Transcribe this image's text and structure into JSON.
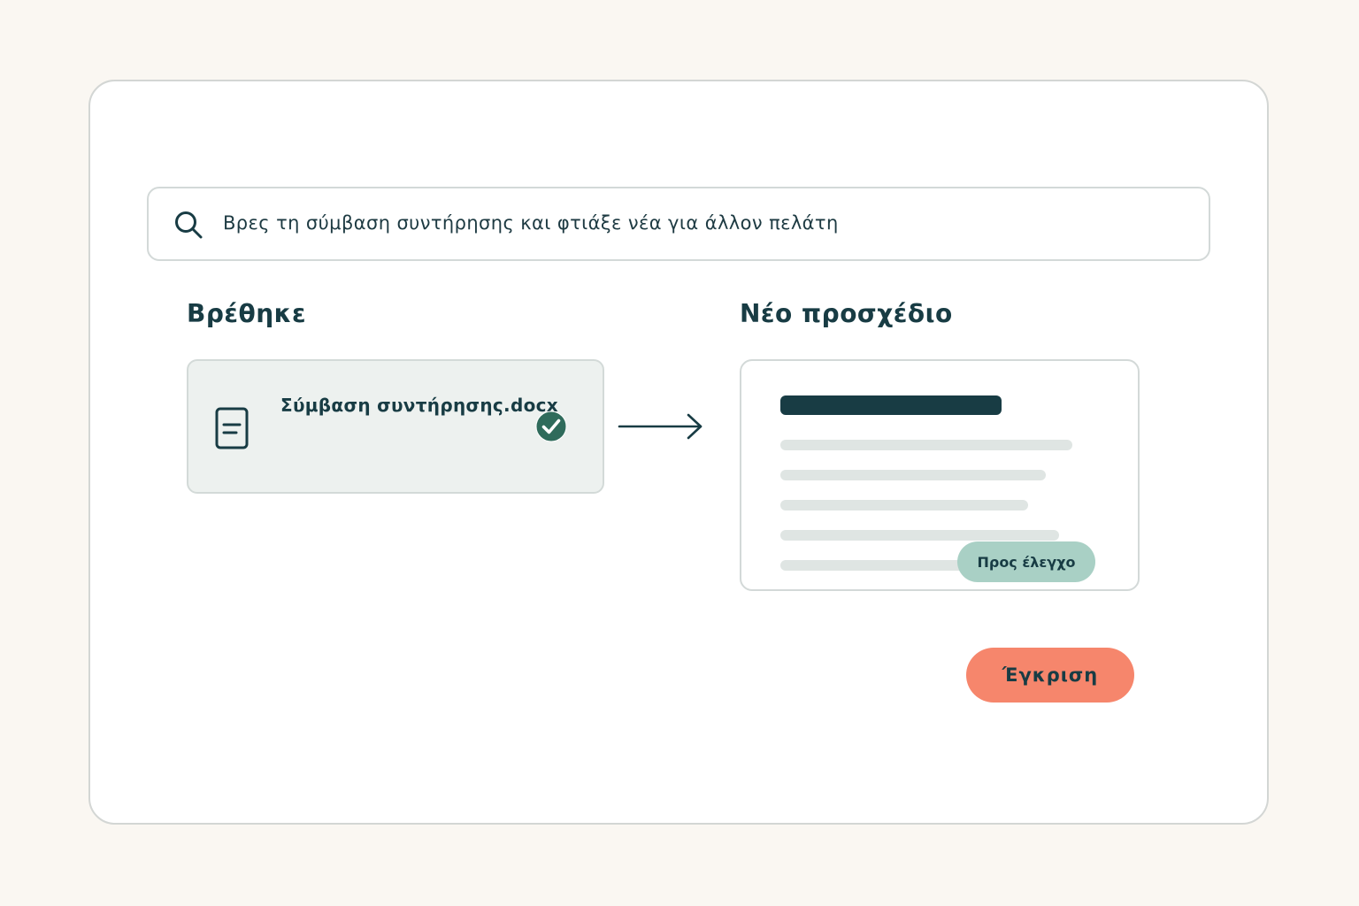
{
  "search": {
    "query": "Βρες τη σύμβαση συντήρησης και φτιάξε νέα για άλλον πελάτη",
    "icon": "search-icon"
  },
  "found_section": {
    "heading": "Βρέθηκε",
    "file": {
      "name": "Σύμβαση συντήρησης.docx",
      "icon": "document-icon",
      "status_icon": "check-circle-icon"
    }
  },
  "transition": {
    "icon": "arrow-right-icon"
  },
  "draft_section": {
    "heading": "Νέο προσχέδιο",
    "badge": "Προς έλεγχο"
  },
  "actions": {
    "approve_label": "Έγκριση"
  },
  "colors": {
    "background": "#faf7f2",
    "primary_dark": "#183c44",
    "accent_button": "#f6866c",
    "badge": "#a9d0c5",
    "check": "#2f6b5b",
    "card_fill": "#edf1ef",
    "placeholder_line": "#dfe5e3"
  }
}
